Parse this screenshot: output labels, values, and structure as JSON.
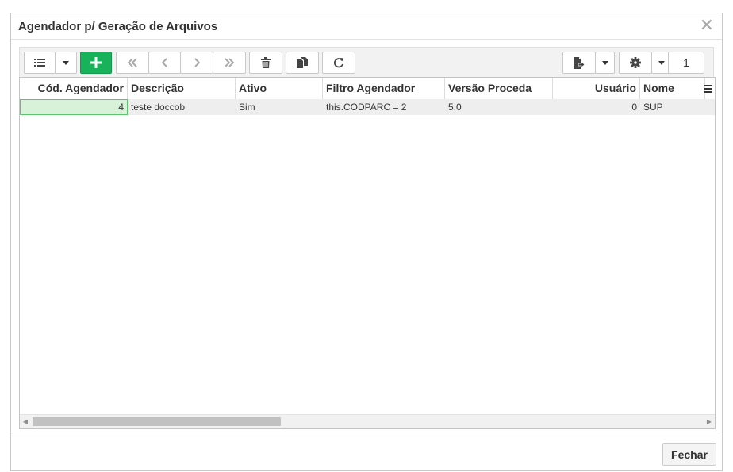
{
  "dialog": {
    "title": "Agendador p/ Geração de Arquivos",
    "close_label": "Fechar"
  },
  "toolbar": {
    "page_number": "1",
    "icons": [
      "list-icon",
      "caret-down-icon",
      "plus-icon",
      "first-page-icon",
      "prev-page-icon",
      "next-page-icon",
      "last-page-icon",
      "trash-icon",
      "copy-icon",
      "refresh-icon",
      "export-file-icon",
      "gear-icon"
    ],
    "accent_color": "#17b25a"
  },
  "grid": {
    "columns": [
      {
        "label": "Cód. Agendador",
        "align": "right"
      },
      {
        "label": "Descrição",
        "align": "left"
      },
      {
        "label": "Ativo",
        "align": "left"
      },
      {
        "label": "Filtro Agendador",
        "align": "left"
      },
      {
        "label": "Versão Proceda",
        "align": "left"
      },
      {
        "label": "Usuário",
        "align": "right"
      },
      {
        "label": "Nome",
        "align": "left"
      }
    ],
    "rows": [
      {
        "cod_agendador": "4",
        "descricao": "teste doccob",
        "ativo": "Sim",
        "filtro_agendador": "this.CODPARC = 2",
        "versao_proceda": "5.0",
        "usuario": "0",
        "nome": "SUP"
      }
    ],
    "selection_color": "#d7f2d9"
  }
}
